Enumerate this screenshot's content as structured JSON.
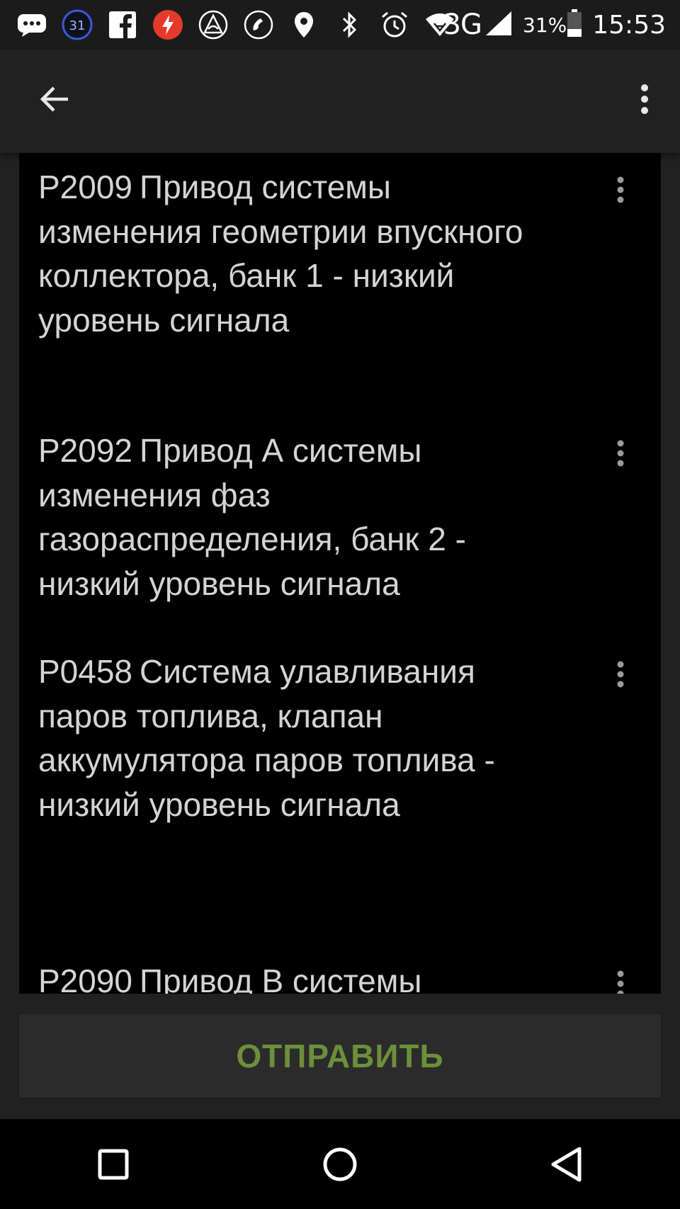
{
  "status_bar": {
    "notifications": [
      {
        "icon": "message-icon"
      },
      {
        "icon": "calendar-icon",
        "label": "31"
      },
      {
        "icon": "facebook-icon"
      },
      {
        "icon": "flash-app-icon"
      },
      {
        "icon": "app-triangle-icon"
      },
      {
        "icon": "phone-call-icon"
      }
    ],
    "system": [
      "location-icon",
      "bluetooth-icon",
      "alarm-icon",
      "wifi-icon"
    ],
    "network": "3G",
    "battery": "31%",
    "time": "15:53"
  },
  "appbar": {
    "back_icon": "arrow-left-icon",
    "overflow_icon": "more-vert-icon"
  },
  "items": [
    {
      "code": "P2009",
      "description": "Привод системы изменения геометрии впускного коллектора, банк 1 - низкий уровень сигнала"
    },
    {
      "code": "P2092",
      "description": "Привод А системы изменения фаз газораспределения, банк 2 - низкий уровень сигнала"
    },
    {
      "code": "P0458",
      "description": "Система улавливания паров топлива, клапан аккумулятора паров топлива - низкий уровень сигнала"
    },
    {
      "code": "P2090",
      "description": "Привод В системы"
    }
  ],
  "send_button": {
    "label": "ОТПРАВИТЬ"
  },
  "nav": {
    "recents_icon": "square-recents-icon",
    "home_icon": "circle-home-icon",
    "back_icon": "triangle-back-icon"
  },
  "colors": {
    "accent": "#6b8f3a",
    "background": "#212121",
    "list_background": "#000000",
    "text": "#d4d4d4"
  }
}
